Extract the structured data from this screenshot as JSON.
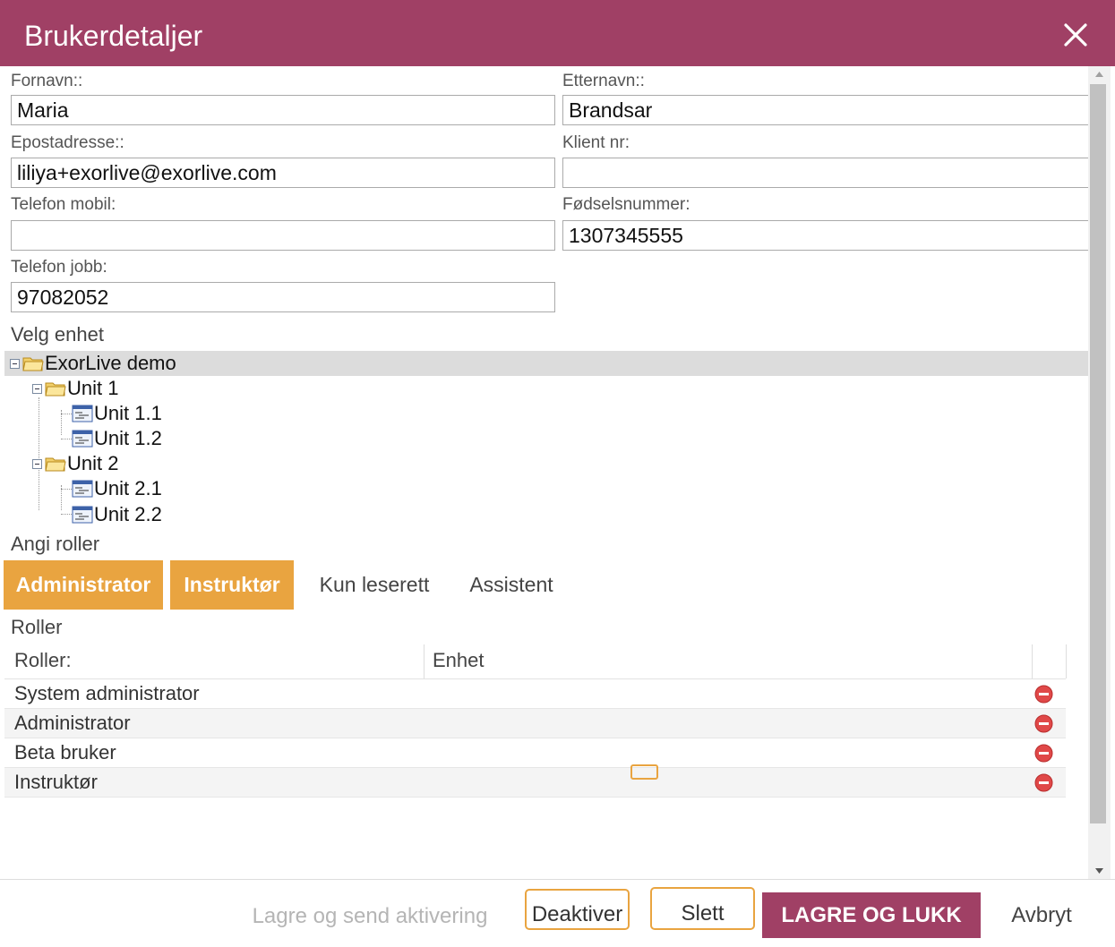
{
  "dialog": {
    "title": "Brukerdetaljer"
  },
  "form": {
    "first_name": {
      "label": "Fornavn::",
      "value": "Maria"
    },
    "last_name": {
      "label": "Etternavn::",
      "value": "Brandsar"
    },
    "email": {
      "label": "Epostadresse::",
      "value": "liliya+exorlive@exorlive.com"
    },
    "client_no": {
      "label": "Klient nr:",
      "value": ""
    },
    "mobile": {
      "label": "Telefon mobil:",
      "value": ""
    },
    "birth_no": {
      "label": "Fødselsnummer:",
      "value": "1307345555"
    },
    "work_phone": {
      "label": "Telefon jobb:",
      "value": "97082052"
    }
  },
  "unit_section": {
    "label": "Velg enhet"
  },
  "tree": {
    "root": "ExorLive demo",
    "unit1": "Unit 1",
    "unit1_1": "Unit 1.1",
    "unit1_2": "Unit 1.2",
    "unit2": "Unit 2",
    "unit2_1": "Unit 2.1",
    "unit2_2": "Unit 2.2"
  },
  "roles_section": {
    "label": "Angi roller"
  },
  "role_buttons": {
    "administrator": "Administrator",
    "instructor": "Instruktør",
    "readonly": "Kun leserett",
    "assistant": "Assistent"
  },
  "roles_table": {
    "label": "Roller",
    "col_role": "Roller:",
    "col_unit": "Enhet",
    "rows": [
      "System administrator",
      "Administrator",
      "Beta bruker",
      "Instruktør"
    ]
  },
  "footer": {
    "save_send": "Lagre og send aktivering",
    "deactivate": "Deaktiver",
    "delete": "Slett",
    "save_close": "LAGRE OG LUKK",
    "cancel": "Avbryt"
  },
  "colors": {
    "header": "#a04065",
    "accent": "#e9a440",
    "delete": "#e04848"
  }
}
